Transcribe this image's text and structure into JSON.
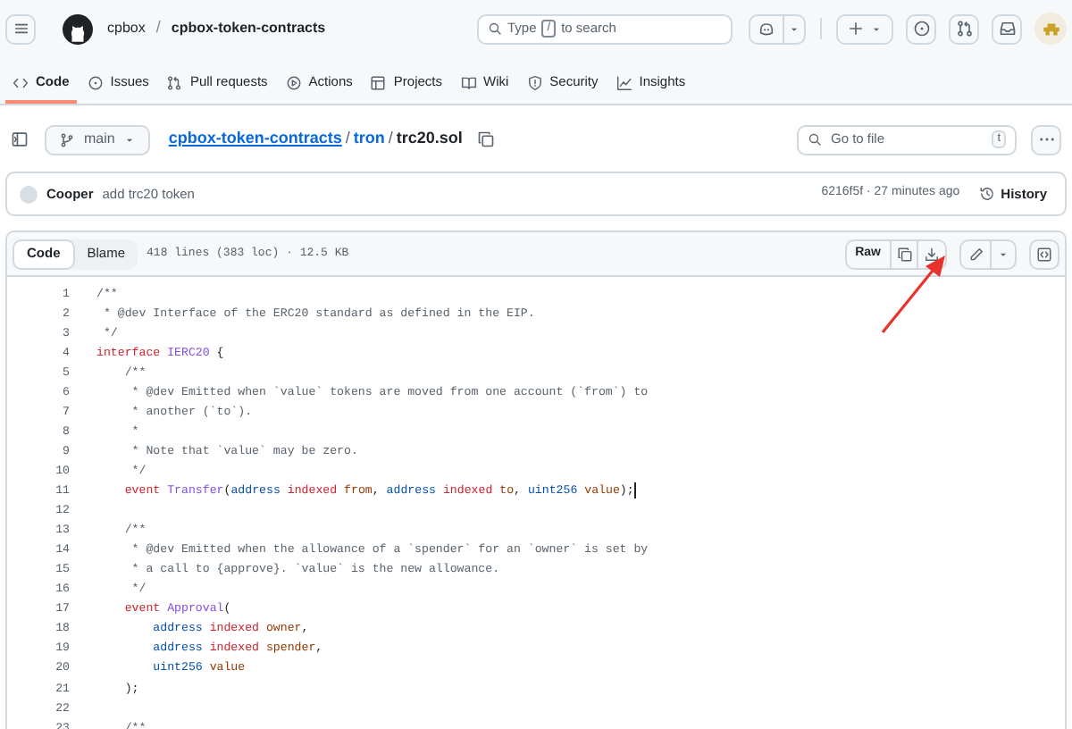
{
  "header": {
    "owner": "cpbox",
    "separator": "/",
    "repo": "cpbox-token-contracts",
    "search": {
      "prefix": "Type",
      "key": "/",
      "suffix": "to search"
    }
  },
  "nav_tabs": [
    {
      "label": "Code",
      "selected": true
    },
    {
      "label": "Issues",
      "selected": false
    },
    {
      "label": "Pull requests",
      "selected": false
    },
    {
      "label": "Actions",
      "selected": false
    },
    {
      "label": "Projects",
      "selected": false
    },
    {
      "label": "Wiki",
      "selected": false
    },
    {
      "label": "Security",
      "selected": false
    },
    {
      "label": "Insights",
      "selected": false
    }
  ],
  "file_bar": {
    "branch": "main",
    "path": [
      {
        "text": "cpbox-token-contracts",
        "kind": "link"
      },
      {
        "text": "/",
        "kind": "separator"
      },
      {
        "text": "tron",
        "kind": "link"
      },
      {
        "text": "/",
        "kind": "separator"
      },
      {
        "text": "trc20.sol",
        "kind": "current"
      }
    ],
    "go_to_file": {
      "placeholder": "Go to file",
      "shortcut": "t"
    }
  },
  "commit": {
    "author": "Cooper",
    "message": "add trc20 token",
    "sha_time": "6216f5f · 27 minutes ago",
    "history": "History"
  },
  "code_view": {
    "tabs": [
      {
        "label": "Code",
        "selected": true
      },
      {
        "label": "Blame",
        "selected": false
      }
    ],
    "info": "418 lines (383 loc) · 12.5 KB",
    "raw": "Raw",
    "lines": [
      {
        "number": "1",
        "tokens": [
          {
            "kind": "comment",
            "text": "/**"
          }
        ]
      },
      {
        "number": "2",
        "tokens": [
          {
            "kind": "comment",
            "text": " * @dev Interface of the ERC20 standard as defined in the EIP."
          }
        ]
      },
      {
        "number": "3",
        "tokens": [
          {
            "kind": "comment",
            "text": " */"
          }
        ]
      },
      {
        "number": "4",
        "tokens": [
          {
            "kind": "keyword",
            "text": "interface"
          },
          {
            "kind": "entity",
            "text": " IERC20"
          },
          {
            "kind": "plain",
            "text": " {"
          }
        ]
      },
      {
        "number": "5",
        "tokens": [
          {
            "kind": "comment",
            "text": "    /**"
          }
        ]
      },
      {
        "number": "6",
        "tokens": [
          {
            "kind": "comment",
            "text": "     * @dev Emitted when `value` tokens are moved from one account (`from`) to"
          }
        ]
      },
      {
        "number": "7",
        "tokens": [
          {
            "kind": "comment",
            "text": "     * another (`to`)."
          }
        ]
      },
      {
        "number": "8",
        "tokens": [
          {
            "kind": "comment",
            "text": "     *"
          }
        ]
      },
      {
        "number": "9",
        "tokens": [
          {
            "kind": "comment",
            "text": "     * Note that `value` may be zero."
          }
        ]
      },
      {
        "number": "10",
        "tokens": [
          {
            "kind": "comment",
            "text": "     */"
          }
        ]
      },
      {
        "number": "11",
        "cursor": true,
        "tokens": [
          {
            "kind": "keyword",
            "text": "    event"
          },
          {
            "kind": "entity",
            "text": " Transfer"
          },
          {
            "kind": "plain",
            "text": "("
          },
          {
            "kind": "type",
            "text": "address"
          },
          {
            "kind": "keyword",
            "text": " indexed"
          },
          {
            "kind": "variable",
            "text": " from"
          },
          {
            "kind": "plain",
            "text": ", "
          },
          {
            "kind": "type",
            "text": "address"
          },
          {
            "kind": "keyword",
            "text": " indexed"
          },
          {
            "kind": "variable",
            "text": " to"
          },
          {
            "kind": "plain",
            "text": ", "
          },
          {
            "kind": "type",
            "text": "uint256"
          },
          {
            "kind": "variable",
            "text": " value"
          },
          {
            "kind": "plain",
            "text": ");"
          }
        ]
      },
      {
        "number": "12"
      },
      {
        "number": "13",
        "tokens": [
          {
            "kind": "comment",
            "text": "    /**"
          }
        ]
      },
      {
        "number": "14",
        "tokens": [
          {
            "kind": "comment",
            "text": "     * @dev Emitted when the allowance of a `spender` for an `owner` is set by"
          }
        ]
      },
      {
        "number": "15",
        "tokens": [
          {
            "kind": "comment",
            "text": "     * a call to {approve}. `value` is the new allowance."
          }
        ]
      },
      {
        "number": "16",
        "tokens": [
          {
            "kind": "comment",
            "text": "     */"
          }
        ]
      },
      {
        "number": "17",
        "tokens": [
          {
            "kind": "keyword",
            "text": "    event"
          },
          {
            "kind": "entity",
            "text": " Approval"
          },
          {
            "kind": "plain",
            "text": "("
          }
        ]
      },
      {
        "number": "18",
        "tokens": [
          {
            "kind": "type",
            "text": "        address"
          },
          {
            "kind": "keyword",
            "text": " indexed"
          },
          {
            "kind": "variable",
            "text": " owner"
          },
          {
            "kind": "plain",
            "text": ","
          }
        ]
      },
      {
        "number": "19",
        "tokens": [
          {
            "kind": "type",
            "text": "        address"
          },
          {
            "kind": "keyword",
            "text": " indexed"
          },
          {
            "kind": "variable",
            "text": " spender"
          },
          {
            "kind": "plain",
            "text": ","
          }
        ]
      },
      {
        "number": "20",
        "tokens": [
          {
            "kind": "type",
            "text": "        uint256"
          },
          {
            "kind": "variable",
            "text": " value"
          }
        ]
      },
      {
        "number": "21",
        "tokens": [
          {
            "kind": "plain",
            "text": "    );"
          }
        ]
      },
      {
        "number": "22"
      },
      {
        "number": "23",
        "tokens": [
          {
            "kind": "comment",
            "text": "    /**"
          }
        ]
      }
    ]
  }
}
